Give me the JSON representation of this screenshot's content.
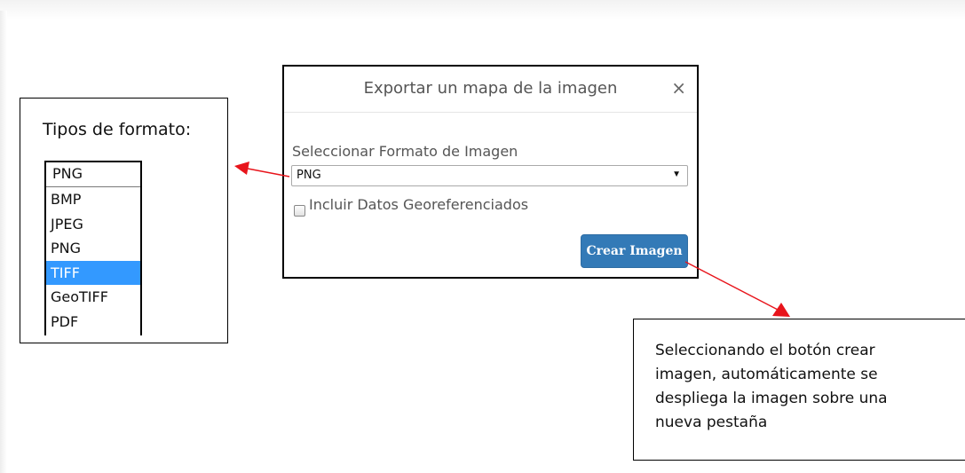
{
  "formats_callout": {
    "title": "Tipos de formato:",
    "selected": "PNG",
    "options": [
      "BMP",
      "JPEG",
      "PNG",
      "TIFF",
      "GeoTIFF",
      "PDF"
    ],
    "highlighted_option": "TIFF"
  },
  "dialog": {
    "title": "Exportar un mapa de la imagen",
    "close_symbol": "×",
    "format_label": "Seleccionar Formato de Imagen",
    "format_value": "PNG",
    "georef_label": "Incluir Datos Georeferenciados",
    "georef_checked": false,
    "create_button": "Crear Imagen"
  },
  "note_callout": {
    "lines": [
      "Seleccionando el botón crear",
      "imagen, automáticamente se",
      "despliega la imagen sobre una",
      "nueva pestaña"
    ]
  },
  "colors": {
    "primary_button": "#337ab7",
    "selected_option": "#3399ff",
    "annotation_arrow": "#e8141b"
  },
  "icons": {
    "close": "close-icon",
    "dropdown": "dropdown-arrow-icon",
    "checkbox": "checkbox-icon",
    "arrow": "arrow-pointer-icon"
  }
}
